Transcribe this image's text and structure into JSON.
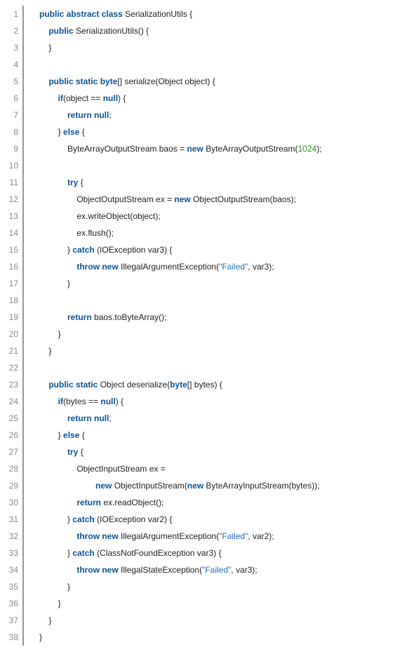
{
  "lineCount": 38,
  "lines": [
    [
      {
        "t": "public abstract class ",
        "c": "kw"
      },
      {
        "t": "SerializationUtils {",
        "c": ""
      }
    ],
    [
      {
        "t": "    ",
        "c": ""
      },
      {
        "t": "public ",
        "c": "kw"
      },
      {
        "t": "SerializationUtils() {",
        "c": ""
      }
    ],
    [
      {
        "t": "    }",
        "c": ""
      }
    ],
    [
      {
        "t": "",
        "c": ""
      }
    ],
    [
      {
        "t": "    ",
        "c": ""
      },
      {
        "t": "public static byte",
        "c": "kw"
      },
      {
        "t": "[] serialize(Object object) {",
        "c": ""
      }
    ],
    [
      {
        "t": "        ",
        "c": ""
      },
      {
        "t": "if",
        "c": "kw"
      },
      {
        "t": "(object == ",
        "c": ""
      },
      {
        "t": "null",
        "c": "kw"
      },
      {
        "t": ") {",
        "c": ""
      }
    ],
    [
      {
        "t": "            ",
        "c": ""
      },
      {
        "t": "return null",
        "c": "kw"
      },
      {
        "t": ";",
        "c": ""
      }
    ],
    [
      {
        "t": "        } ",
        "c": ""
      },
      {
        "t": "else ",
        "c": "kw"
      },
      {
        "t": "{",
        "c": ""
      }
    ],
    [
      {
        "t": "            ByteArrayOutputStream baos = ",
        "c": ""
      },
      {
        "t": "new ",
        "c": "kw"
      },
      {
        "t": "ByteArrayOutputStream(",
        "c": ""
      },
      {
        "t": "1024",
        "c": "num"
      },
      {
        "t": ");",
        "c": ""
      }
    ],
    [
      {
        "t": "",
        "c": ""
      }
    ],
    [
      {
        "t": "            ",
        "c": ""
      },
      {
        "t": "try ",
        "c": "kw"
      },
      {
        "t": "{",
        "c": ""
      }
    ],
    [
      {
        "t": "                ObjectOutputStream ex = ",
        "c": ""
      },
      {
        "t": "new ",
        "c": "kw"
      },
      {
        "t": "ObjectOutputStream(baos);",
        "c": ""
      }
    ],
    [
      {
        "t": "                ex.writeObject(object);",
        "c": ""
      }
    ],
    [
      {
        "t": "                ex.flush();",
        "c": ""
      }
    ],
    [
      {
        "t": "            } ",
        "c": ""
      },
      {
        "t": "catch ",
        "c": "kw"
      },
      {
        "t": "(IOException var3) {",
        "c": ""
      }
    ],
    [
      {
        "t": "                ",
        "c": ""
      },
      {
        "t": "throw new ",
        "c": "kw"
      },
      {
        "t": "IllegalArgumentException(",
        "c": ""
      },
      {
        "t": "\"Failed\"",
        "c": "str"
      },
      {
        "t": ", var3);",
        "c": ""
      }
    ],
    [
      {
        "t": "            }",
        "c": ""
      }
    ],
    [
      {
        "t": "",
        "c": ""
      }
    ],
    [
      {
        "t": "            ",
        "c": ""
      },
      {
        "t": "return ",
        "c": "kw"
      },
      {
        "t": "baos.toByteArray();",
        "c": ""
      }
    ],
    [
      {
        "t": "        }",
        "c": ""
      }
    ],
    [
      {
        "t": "    }",
        "c": ""
      }
    ],
    [
      {
        "t": "",
        "c": ""
      }
    ],
    [
      {
        "t": "    ",
        "c": ""
      },
      {
        "t": "public static ",
        "c": "kw"
      },
      {
        "t": "Object deserialize(",
        "c": ""
      },
      {
        "t": "byte",
        "c": "kw"
      },
      {
        "t": "[] bytes) {",
        "c": ""
      }
    ],
    [
      {
        "t": "        ",
        "c": ""
      },
      {
        "t": "if",
        "c": "kw"
      },
      {
        "t": "(bytes == ",
        "c": ""
      },
      {
        "t": "null",
        "c": "kw"
      },
      {
        "t": ") {",
        "c": ""
      }
    ],
    [
      {
        "t": "            ",
        "c": ""
      },
      {
        "t": "return null",
        "c": "kw"
      },
      {
        "t": ";",
        "c": ""
      }
    ],
    [
      {
        "t": "        } ",
        "c": ""
      },
      {
        "t": "else ",
        "c": "kw"
      },
      {
        "t": "{",
        "c": ""
      }
    ],
    [
      {
        "t": "            ",
        "c": ""
      },
      {
        "t": "try ",
        "c": "kw"
      },
      {
        "t": "{",
        "c": ""
      }
    ],
    [
      {
        "t": "                ObjectInputStream ex =",
        "c": ""
      }
    ],
    [
      {
        "t": "                        ",
        "c": ""
      },
      {
        "t": "new ",
        "c": "kw"
      },
      {
        "t": "ObjectInputStream(",
        "c": ""
      },
      {
        "t": "new ",
        "c": "kw"
      },
      {
        "t": "ByteArrayInputStream(bytes));",
        "c": ""
      }
    ],
    [
      {
        "t": "                ",
        "c": ""
      },
      {
        "t": "return ",
        "c": "kw"
      },
      {
        "t": "ex.readObject();",
        "c": ""
      }
    ],
    [
      {
        "t": "            } ",
        "c": ""
      },
      {
        "t": "catch ",
        "c": "kw"
      },
      {
        "t": "(IOException var2) {",
        "c": ""
      }
    ],
    [
      {
        "t": "                ",
        "c": ""
      },
      {
        "t": "throw new ",
        "c": "kw"
      },
      {
        "t": "IllegalArgumentException(",
        "c": ""
      },
      {
        "t": "\"Failed\"",
        "c": "str"
      },
      {
        "t": ", var2);",
        "c": ""
      }
    ],
    [
      {
        "t": "            } ",
        "c": ""
      },
      {
        "t": "catch ",
        "c": "kw"
      },
      {
        "t": "(ClassNotFoundException var3) {",
        "c": ""
      }
    ],
    [
      {
        "t": "                ",
        "c": ""
      },
      {
        "t": "throw new ",
        "c": "kw"
      },
      {
        "t": "IllegalStateException(",
        "c": ""
      },
      {
        "t": "\"Failed\"",
        "c": "str"
      },
      {
        "t": ", var3);",
        "c": ""
      }
    ],
    [
      {
        "t": "            }",
        "c": ""
      }
    ],
    [
      {
        "t": "        }",
        "c": ""
      }
    ],
    [
      {
        "t": "    }",
        "c": ""
      }
    ],
    [
      {
        "t": "}",
        "c": ""
      }
    ]
  ]
}
